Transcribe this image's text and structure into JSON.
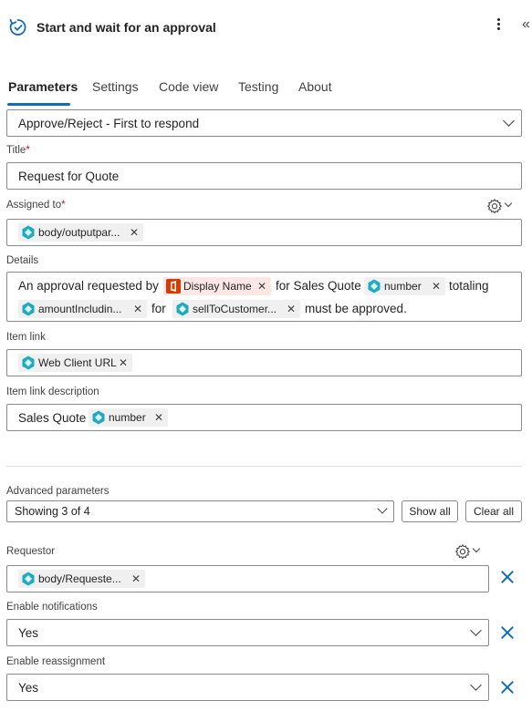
{
  "header": {
    "title": "Start and wait for an approval"
  },
  "tabs": [
    "Parameters",
    "Settings",
    "Code view",
    "Testing",
    "About"
  ],
  "approval_type": {
    "value": "Approve/Reject - First to respond"
  },
  "title_field": {
    "label": "Title",
    "required_mark": "*",
    "value": "Request for Quote"
  },
  "assigned_to": {
    "label": "Assigned to",
    "required_mark": "*",
    "token": "body/outputpar..."
  },
  "details": {
    "label": "Details",
    "line1": {
      "text1": "An approval requested by",
      "token1": "Display Name",
      "text2": "for Sales Quote",
      "token2": "number",
      "text3": "totaling"
    },
    "line2": {
      "token1": "amountIncludin...",
      "text1": "for",
      "token2": "sellToCustomer...",
      "text2": "must be approved."
    }
  },
  "item_link": {
    "label": "Item link",
    "token": "Web Client URL"
  },
  "item_link_description": {
    "label": "Item link description",
    "text": "Sales Quote",
    "token": "number"
  },
  "advanced": {
    "label": "Advanced parameters",
    "showing": "Showing 3 of 4",
    "show_all": "Show all",
    "clear_all": "Clear all"
  },
  "requestor": {
    "label": "Requestor",
    "token": "body/Requeste..."
  },
  "enable_notifications": {
    "label": "Enable notifications",
    "value": "Yes"
  },
  "enable_reassignment": {
    "label": "Enable reassignment",
    "value": "Yes"
  },
  "colors": {
    "accent": "#0f6cbd",
    "required": "#c50f1f",
    "office_red": "#d83b01",
    "token_bg": "#f0f0f0"
  },
  "icons": [
    "approval-flow-icon",
    "more-options-icon",
    "collapse-panel-icon",
    "dynamic-content-icon",
    "office-icon",
    "settings-icon",
    "remove-icon"
  ]
}
